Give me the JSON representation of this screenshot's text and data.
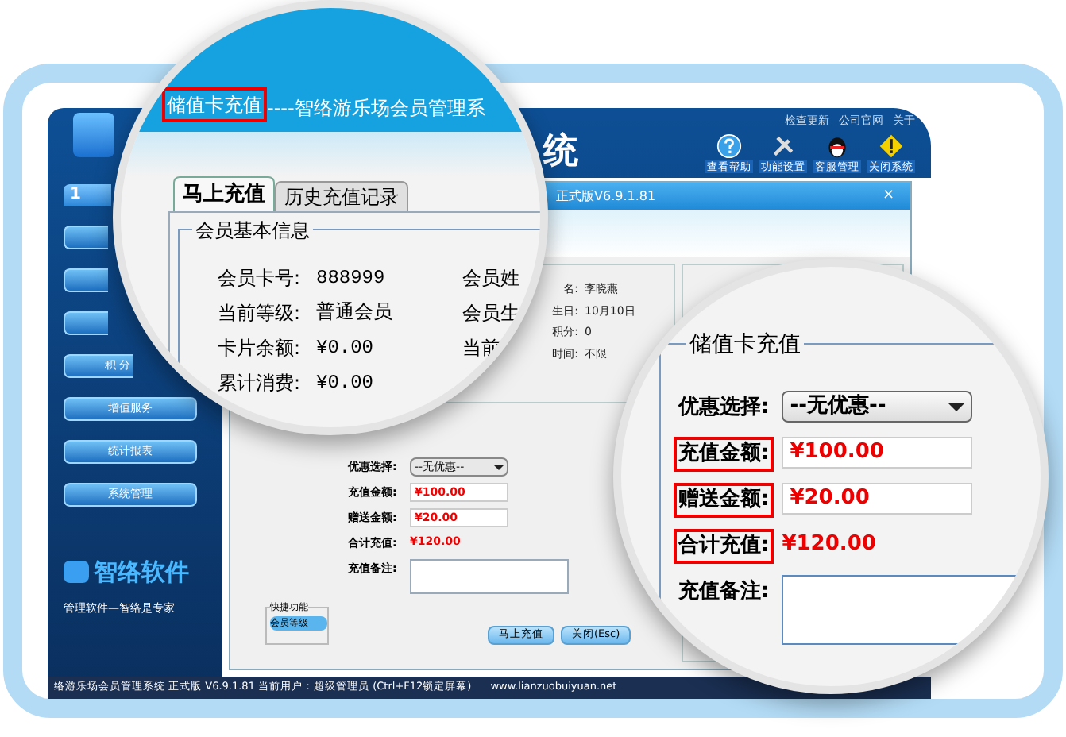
{
  "header": {
    "links": [
      "检查更新",
      "公司官网",
      "关于"
    ],
    "title_fragment": "统",
    "tools": [
      {
        "kind": "help",
        "label": "查看帮助"
      },
      {
        "kind": "settings",
        "label": "功能设置"
      },
      {
        "kind": "service",
        "label": "客服管理"
      },
      {
        "kind": "warning",
        "label": "关闭系统"
      }
    ]
  },
  "sidebar": {
    "tab": "1",
    "items": [
      {
        "label": "积 分"
      },
      {
        "label": "增值服务"
      },
      {
        "label": "统计报表"
      },
      {
        "label": "系统管理"
      }
    ]
  },
  "logo": {
    "name": "智络软件",
    "slogan": "管理软件—智络是专家"
  },
  "dialog": {
    "title": "正式版V6.9.1.81",
    "close": "×",
    "member_fragments": [
      {
        "label": "名:",
        "value": "李晓燕"
      },
      {
        "label": "生日:",
        "value": "10月10日"
      },
      {
        "label": "积分:",
        "value": "0"
      },
      {
        "label": "时间:",
        "value": "不限"
      }
    ],
    "form": [
      {
        "kind": "select",
        "label": "优惠选择:",
        "value": "--无优惠--"
      },
      {
        "kind": "input",
        "label": "充值金额:",
        "value": "¥100.00"
      },
      {
        "kind": "input",
        "label": "赠送金额:",
        "value": "¥20.00"
      },
      {
        "kind": "total",
        "label": "合计充值:",
        "value": "¥120.00"
      },
      {
        "kind": "textarea",
        "label": "充值备注:"
      }
    ],
    "quick": {
      "title": "快捷功能",
      "buttons": [
        "会员等级"
      ]
    },
    "buttons": [
      "马上充值",
      "关闭(Esc)"
    ]
  },
  "status_bar": {
    "text": "络游乐场会员管理系统 正式版 V6.9.1.81 当前用户：超级管理员 (Ctrl+F12锁定屏幕)",
    "url": "www.lianzuobuiyuan.net"
  },
  "magnifier_left": {
    "title_highlight": "储值卡充值",
    "title_rest": "----智络游乐场会员管理系",
    "tabs": [
      {
        "label": "马上充值",
        "selected": true
      },
      {
        "label": "历史充值记录",
        "selected": false
      }
    ],
    "group": "会员基本信息",
    "rows": [
      {
        "label": "会员卡号:",
        "value": "888999",
        "right": "会员姓"
      },
      {
        "label": "当前等级:",
        "value": "普通会员",
        "right": "会员生"
      },
      {
        "label": "卡片余额:",
        "value": "¥0.00",
        "right": "当前"
      },
      {
        "label": "累计消费:",
        "value": "¥0.00"
      }
    ]
  },
  "magnifier_right": {
    "group": "储值卡充值",
    "rows": [
      {
        "kind": "select",
        "label": "优惠选择:",
        "value": "--无优惠--",
        "highlighted": false
      },
      {
        "kind": "input",
        "label": "充值金额:",
        "value": "¥100.00",
        "highlighted": true
      },
      {
        "kind": "input",
        "label": "赠送金额:",
        "value": "¥20.00",
        "highlighted": true
      },
      {
        "kind": "total",
        "label": "合计充值:",
        "value": "¥120.00",
        "highlighted": true
      },
      {
        "kind": "textarea",
        "label": "充值备注:",
        "highlighted": false
      }
    ]
  }
}
